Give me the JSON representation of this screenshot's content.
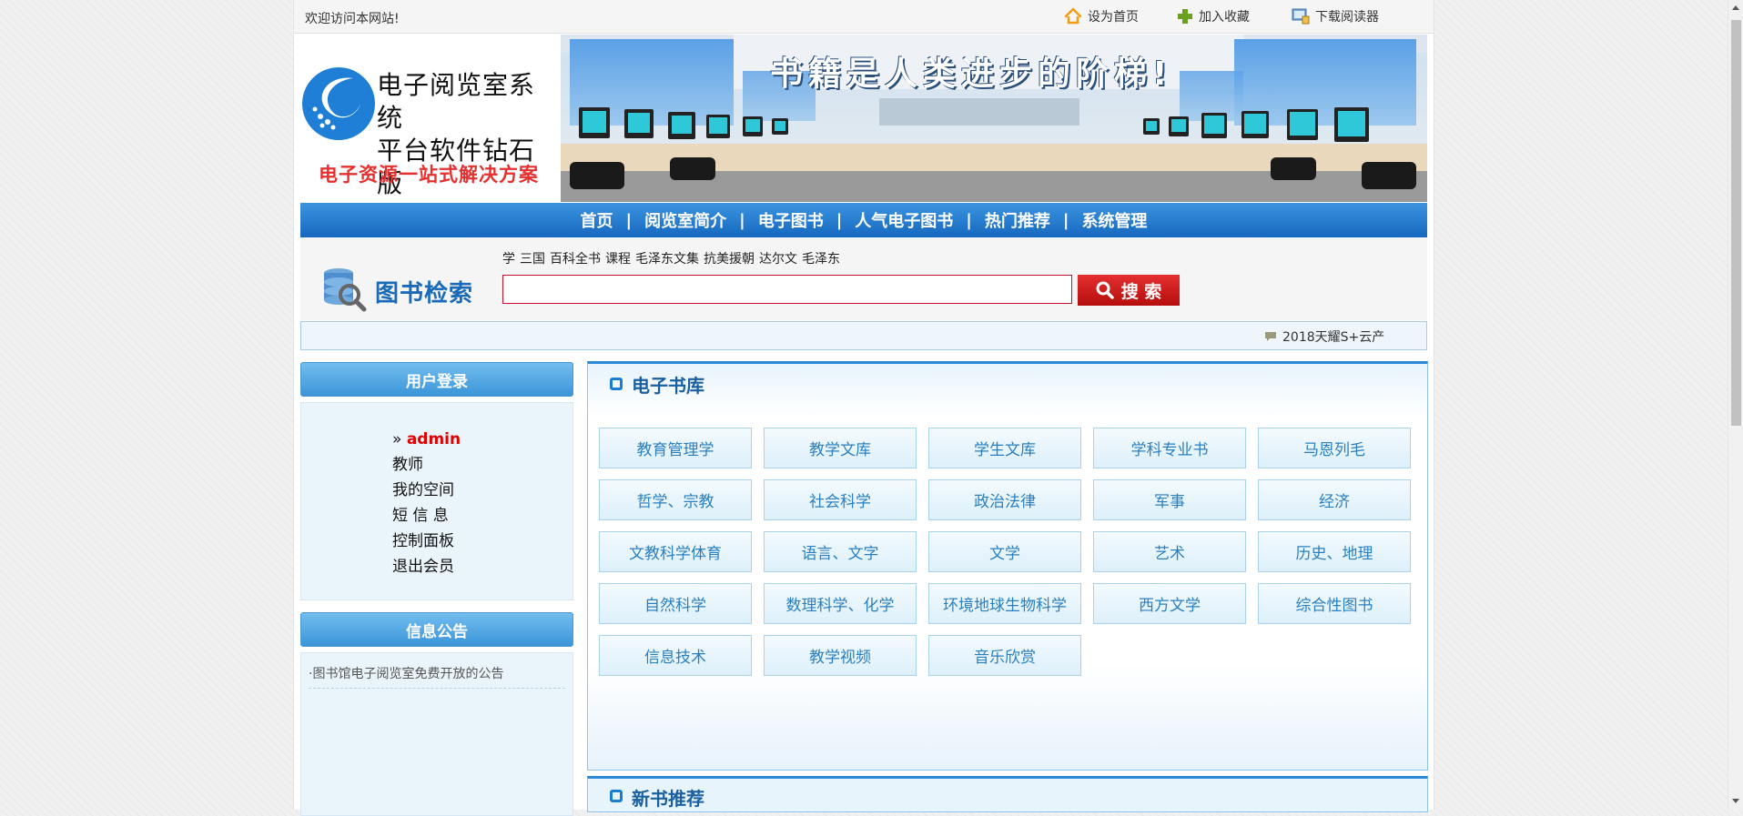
{
  "topbar": {
    "welcome": "欢迎访问本网站!",
    "links": [
      {
        "label": "设为首页",
        "icon": "home-icon"
      },
      {
        "label": "加入收藏",
        "icon": "plus-icon"
      },
      {
        "label": "下载阅读器",
        "icon": "reader-icon"
      }
    ]
  },
  "banner": {
    "title_line1": "电子阅览室系统",
    "title_line2": "平台软件钻石版",
    "subtitle": "电子资源一站式解决方案",
    "slogan": "书籍是人类进步的阶梯!"
  },
  "nav": {
    "items": [
      "首页",
      "阅览室简介",
      "电子图书",
      "人气电子图书",
      "热门推荐",
      "系统管理"
    ],
    "separator": "|"
  },
  "search": {
    "title": "图书检索",
    "hotwords": [
      "学",
      "三国",
      "百科全书",
      "课程",
      "毛泽东文集",
      "抗美援朝",
      "达尔文",
      "毛泽东"
    ],
    "value": "",
    "button": "搜 索"
  },
  "marquee": {
    "text": "2018天耀S+云产"
  },
  "login": {
    "heading": "用户登录",
    "prefix": "»",
    "username": "admin",
    "items": [
      "教师",
      "我的空间",
      "短 信 息",
      "控制面板",
      "退出会员"
    ]
  },
  "notice": {
    "heading": "信息公告",
    "items": [
      "·图书馆电子阅览室免费开放的公告"
    ]
  },
  "ebooks": {
    "title": "电子书库",
    "categories": [
      "教育管理学",
      "教学文库",
      "学生文库",
      "学科专业书",
      "马恩列毛",
      "哲学、宗教",
      "社会科学",
      "政治法律",
      "军事",
      "经济",
      "文教科学体育",
      "语言、文字",
      "文学",
      "艺术",
      "历史、地理",
      "自然科学",
      "数理科学、化学",
      "环境地球生物科学",
      "西方文学",
      "综合性图书",
      "信息技术",
      "教学视频",
      "音乐欣赏"
    ]
  },
  "newbooks": {
    "title": "新书推荐"
  },
  "colors": {
    "nav_blue": "#1e78cf",
    "accent_red": "#e53030",
    "link_blue": "#2a7fc0"
  }
}
